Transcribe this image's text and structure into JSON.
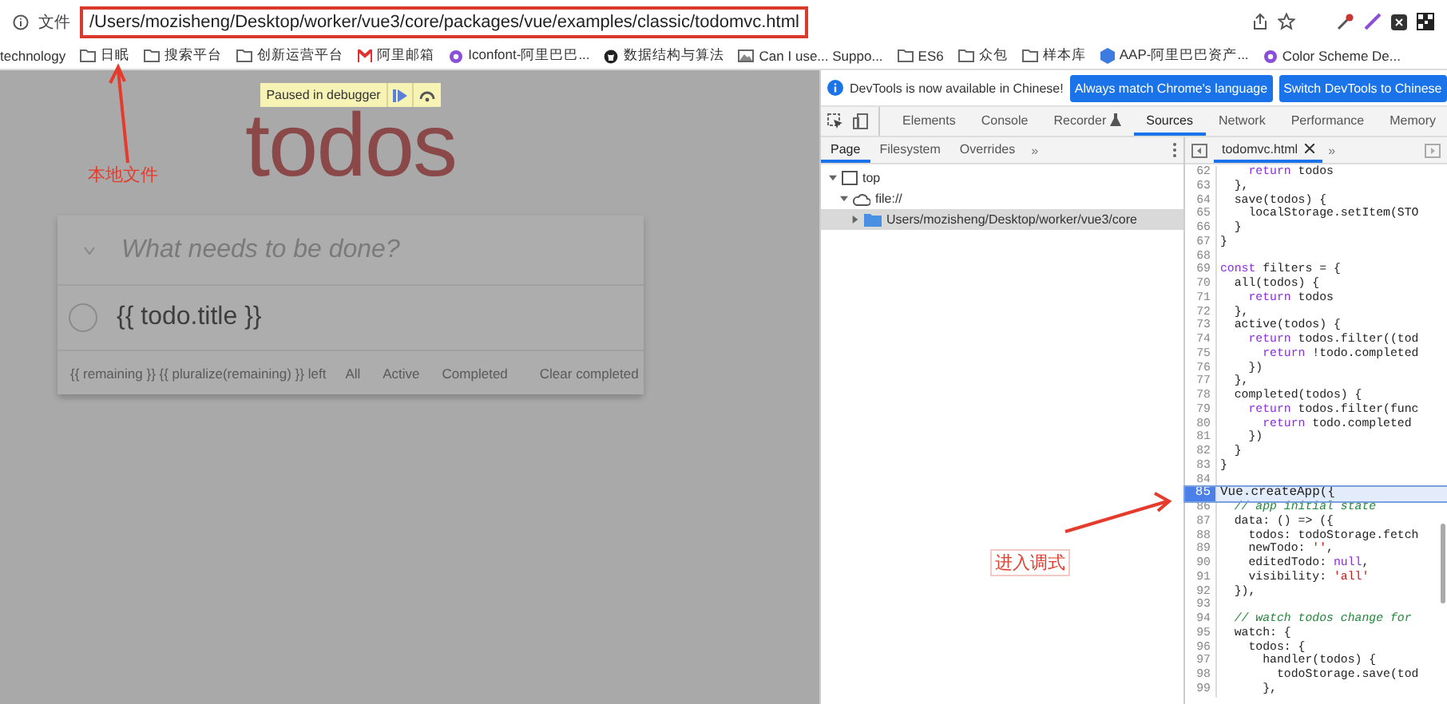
{
  "address_bar": {
    "scheme_label": "文件",
    "url": "/Users/mozisheng/Desktop/worker/vue3/core/packages/vue/examples/classic/todomvc.html"
  },
  "bookmarks": [
    {
      "label": "technology",
      "kind": "none"
    },
    {
      "label": "日眠",
      "kind": "folder"
    },
    {
      "label": "搜索平台",
      "kind": "folder"
    },
    {
      "label": "创新运营平台",
      "kind": "folder"
    },
    {
      "label": "阿里邮箱",
      "kind": "mail"
    },
    {
      "label": "Iconfont-阿里巴巴...",
      "kind": "site"
    },
    {
      "label": "数据结构与算法",
      "kind": "github"
    },
    {
      "label": "Can I use... Suppo...",
      "kind": "image"
    },
    {
      "label": "ES6",
      "kind": "folder"
    },
    {
      "label": "众包",
      "kind": "folder"
    },
    {
      "label": "样本库",
      "kind": "folder"
    },
    {
      "label": "AAP-阿里巴巴资产...",
      "kind": "hex"
    },
    {
      "label": "Color Scheme De...",
      "kind": "site"
    }
  ],
  "page": {
    "paused_banner": "Paused in debugger",
    "title": "todos",
    "new_todo": {
      "placeholder": "What needs to be done?"
    },
    "todos": [
      {
        "title": "{{ todo.title }}",
        "completed": false
      }
    ],
    "footer": {
      "count": "{{ remaining }} {{ pluralize(remaining) }} left",
      "filters": [
        {
          "label": "All",
          "selected": false
        },
        {
          "label": "Active",
          "selected": false
        },
        {
          "label": "Completed",
          "selected": false
        }
      ],
      "clear": "Clear completed"
    }
  },
  "devtools": {
    "banner": {
      "message": "DevTools is now available in Chinese!",
      "buttons": [
        "Always match Chrome's language",
        "Switch DevTools to Chinese"
      ]
    },
    "tabs": [
      {
        "label": "Elements",
        "selected": false
      },
      {
        "label": "Console",
        "selected": false
      },
      {
        "label": "Recorder",
        "selected": false
      },
      {
        "label": "Sources",
        "selected": true
      },
      {
        "label": "Network",
        "selected": false
      },
      {
        "label": "Performance",
        "selected": false
      },
      {
        "label": "Memory",
        "selected": false
      }
    ],
    "navigator_tabs": [
      {
        "label": "Page",
        "selected": true
      },
      {
        "label": "Filesystem",
        "selected": false
      },
      {
        "label": "Overrides",
        "selected": false
      }
    ],
    "navigator_more": "»",
    "tree": [
      {
        "label": "top",
        "kind": "frame",
        "expanded": true,
        "selected": false,
        "children": [
          {
            "label": "file://",
            "kind": "cloud",
            "expanded": true,
            "selected": false,
            "children": [
              {
                "label": "Users/mozisheng/Desktop/worker/vue3/core",
                "kind": "folder",
                "expanded": false,
                "selected": true
              }
            ]
          }
        ]
      }
    ],
    "editor_tab": "todomvc.html",
    "editor_more": "»",
    "code_lines": [
      {
        "n": "62",
        "text": "    return todos",
        "kind": "code",
        "paused": false
      },
      {
        "n": "63",
        "text": "  },",
        "kind": "code",
        "paused": false
      },
      {
        "n": "64",
        "text": "  save(todos) {",
        "kind": "code",
        "paused": false
      },
      {
        "n": "65",
        "text": "    localStorage.setItem(STO",
        "kind": "code",
        "paused": false
      },
      {
        "n": "66",
        "text": "  }",
        "kind": "code",
        "paused": false
      },
      {
        "n": "67",
        "text": "}",
        "kind": "code",
        "paused": false
      },
      {
        "n": "68",
        "paused": false
      },
      {
        "n": "69",
        "text": "const filters = {",
        "kind": "code",
        "paused": false
      },
      {
        "n": "70",
        "text": "  all(todos) {",
        "kind": "code",
        "paused": false
      },
      {
        "n": "71",
        "text": "    return todos",
        "kind": "code",
        "paused": false
      },
      {
        "n": "72",
        "text": "  },",
        "kind": "code",
        "paused": false
      },
      {
        "n": "73",
        "text": "  active(todos) {",
        "kind": "code",
        "paused": false
      },
      {
        "n": "74",
        "text": "    return todos.filter((tod",
        "kind": "code",
        "paused": false
      },
      {
        "n": "75",
        "text": "      return !todo.completed",
        "kind": "code",
        "paused": false
      },
      {
        "n": "76",
        "text": "    })",
        "kind": "code",
        "paused": false
      },
      {
        "n": "77",
        "text": "  },",
        "kind": "code",
        "paused": false
      },
      {
        "n": "78",
        "text": "  completed(todos) {",
        "kind": "code",
        "paused": false
      },
      {
        "n": "79",
        "text": "    return todos.filter(func",
        "kind": "code",
        "paused": false
      },
      {
        "n": "80",
        "text": "      return todo.completed",
        "kind": "code",
        "paused": false
      },
      {
        "n": "81",
        "text": "    })",
        "kind": "code",
        "paused": false
      },
      {
        "n": "82",
        "text": "  }",
        "kind": "code",
        "paused": false
      },
      {
        "n": "83",
        "text": "}",
        "kind": "code",
        "paused": false
      },
      {
        "n": "84",
        "paused": false
      },
      {
        "n": "85",
        "text": "Vue.createApp({",
        "kind": "code",
        "paused": true
      },
      {
        "n": "86",
        "text": "  // app initial state",
        "kind": "comment",
        "paused": false
      },
      {
        "n": "87",
        "text": "  data: () => ({",
        "kind": "code",
        "paused": false
      },
      {
        "n": "88",
        "text": "    todos: todoStorage.fetch",
        "kind": "code",
        "paused": false
      },
      {
        "n": "89",
        "text": "    newTodo: '',",
        "kind": "code",
        "paused": false
      },
      {
        "n": "90",
        "text": "    editedTodo: null,",
        "kind": "code",
        "paused": false
      },
      {
        "n": "91",
        "text": "    visibility: 'all'",
        "kind": "code",
        "paused": false
      },
      {
        "n": "92",
        "text": "  }),",
        "kind": "code",
        "paused": false
      },
      {
        "n": "93",
        "paused": false
      },
      {
        "n": "94",
        "text": "  // watch todos change for",
        "kind": "comment",
        "paused": false
      },
      {
        "n": "95",
        "text": "  watch: {",
        "kind": "code",
        "paused": false
      },
      {
        "n": "96",
        "text": "    todos: {",
        "kind": "code",
        "paused": false
      },
      {
        "n": "97",
        "text": "      handler(todos) {",
        "kind": "code",
        "paused": false
      },
      {
        "n": "98",
        "text": "        todoStorage.save(tod",
        "kind": "code",
        "paused": false
      },
      {
        "n": "99",
        "text": "      },",
        "kind": "code",
        "paused": false
      }
    ]
  },
  "annotations": [
    {
      "text": "本地文件"
    },
    {
      "text": "进入调式"
    }
  ]
}
